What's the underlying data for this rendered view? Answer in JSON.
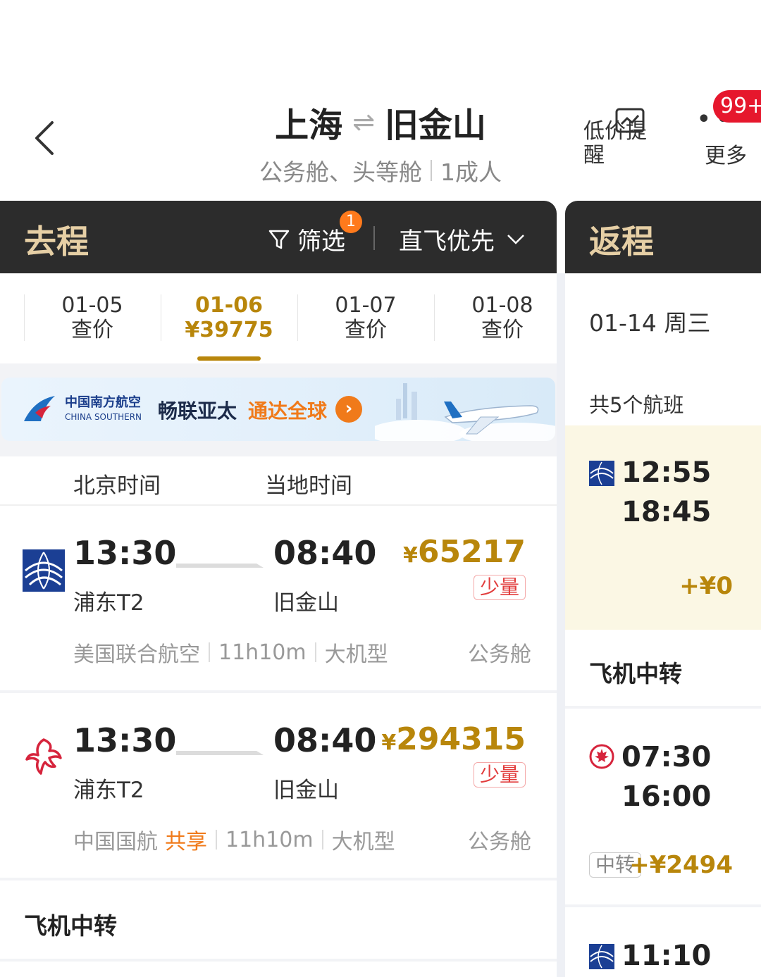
{
  "header": {
    "title_from": "上海",
    "title_arrow": "⇌",
    "title_to": "旧金山",
    "cabin": "公务舱、头等舱",
    "passengers": "1成人",
    "alert_label": "低价提醒",
    "more_label": "更多",
    "notif_badge": "99+"
  },
  "outbound_bar": {
    "label": "去程",
    "filter_label": "筛选",
    "filter_count": "1",
    "sort_label": "直飞优先"
  },
  "return_bar": {
    "label": "返程"
  },
  "dates": [
    {
      "date": "01-05",
      "sub": "查价",
      "selected": false
    },
    {
      "date": "01-06",
      "sub": "¥39775",
      "selected": true
    },
    {
      "date": "01-07",
      "sub": "查价",
      "selected": false
    },
    {
      "date": "01-08",
      "sub": "查价",
      "selected": false
    }
  ],
  "banner": {
    "airline_cn": "中国南方航空",
    "airline_en": "CHINA SOUTHERN",
    "slogan1": "畅联亚太",
    "slogan2": "通达全球"
  },
  "time_header": {
    "left": "北京时间",
    "right": "当地时间"
  },
  "flights": [
    {
      "logo": "united-airlines-logo",
      "dep_time": "13:30",
      "arr_time": "08:40",
      "dep_airport": "浦东T2",
      "arr_airport": "旧金山",
      "currency": "¥",
      "price": "65217",
      "few_label": "少量",
      "airline": "美国联合航空",
      "share": "",
      "duration": "11h10m",
      "aircraft": "大机型",
      "cabin": "公务舱"
    },
    {
      "logo": "air-china-logo",
      "dep_time": "13:30",
      "arr_time": "08:40",
      "dep_airport": "浦东T2",
      "arr_airport": "旧金山",
      "currency": "¥",
      "price": "294315",
      "few_label": "少量",
      "airline": "中国国航",
      "share": "共享",
      "duration": "11h10m",
      "aircraft": "大机型",
      "cabin": "公务舱"
    }
  ],
  "transfer_section": {
    "label": "飞机中转"
  },
  "return": {
    "date": "01-14 周三",
    "count": "共5个航班",
    "flights": [
      {
        "logo": "united-airlines-logo",
        "dep": "12:55",
        "arr": "18:45",
        "price": "+¥0",
        "tag": ""
      },
      {
        "logo": "air-canada-logo",
        "dep": "07:30",
        "arr": "16:00",
        "price": "+¥2494",
        "tag": "中转"
      },
      {
        "logo": "united-airlines-logo",
        "dep": "11:10",
        "arr": "",
        "price": "",
        "tag": ""
      }
    ],
    "transfer_label": "飞机中转"
  },
  "colors": {
    "gold": "#b8860b",
    "dark_bar": "#2c2c2c",
    "bar_label": "#e6cfa5",
    "orange": "#f07a1a",
    "red": "#e6172d"
  }
}
